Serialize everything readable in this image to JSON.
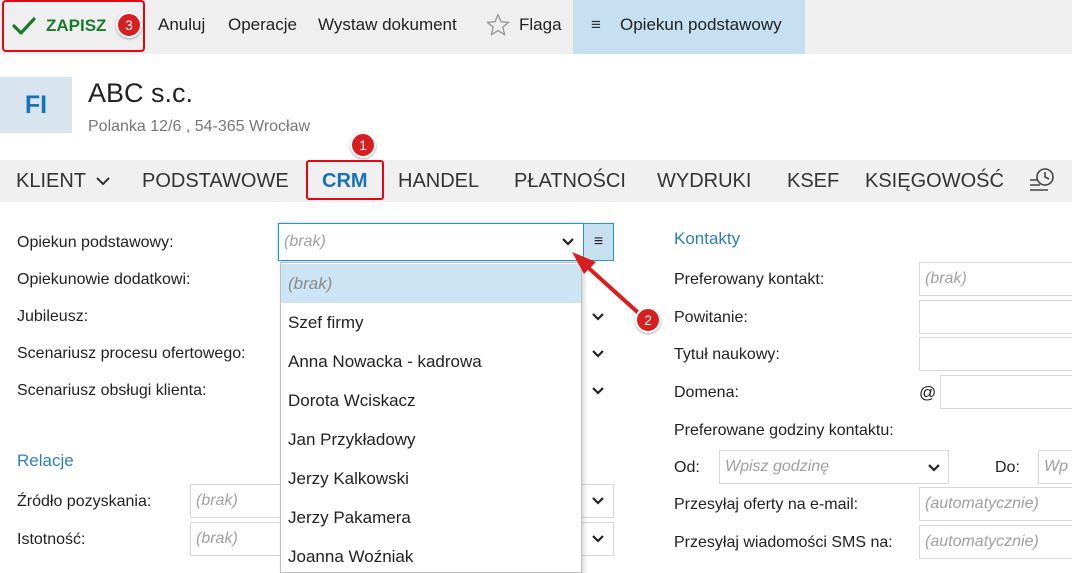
{
  "toolbar": {
    "save_label": "ZAPISZ",
    "cancel_label": "Anuluj",
    "operations_label": "Operacje",
    "issue_document_label": "Wystaw dokument",
    "flag_label": "Flaga",
    "primary_caretaker_label": "Opiekun podstawowy"
  },
  "annotations": {
    "badge_1": "1",
    "badge_2": "2",
    "badge_3": "3"
  },
  "header": {
    "avatar_initials": "FI",
    "company_name": "ABC s.c.",
    "address": "Polanka  12/6 , 54-365 Wrocław"
  },
  "tabs": [
    {
      "label": "KLIENT"
    },
    {
      "label": "PODSTAWOWE"
    },
    {
      "label": "CRM"
    },
    {
      "label": "HANDEL"
    },
    {
      "label": "PŁATNOŚCI"
    },
    {
      "label": "WYDRUKI"
    },
    {
      "label": "KSEF"
    },
    {
      "label": "KSIĘGOWOŚĆ"
    }
  ],
  "crm": {
    "primary_caretaker_label": "Opiekun podstawowy:",
    "primary_caretaker_value": "(brak)",
    "additional_caretakers_label": "Opiekunowie dodatkowi:",
    "anniversary_label": "Jubileusz:",
    "offer_process_label": "Scenariusz procesu ofertowego:",
    "service_scenario_label": "Scenariusz obsługi klienta:",
    "relations_title": "Relacje",
    "source_label": "Źródło pozyskania:",
    "source_value": "(brak)",
    "importance_label": "Istotność:",
    "importance_value": "(brak)"
  },
  "dropdown": {
    "options": [
      "(brak)",
      "Szef firmy",
      "Anna Nowacka - kadrowa",
      "Dorota Wciskacz",
      "Jan Przykładowy",
      "Jerzy Kalkowski",
      "Jerzy Pakamera",
      "Joanna Woźniak"
    ],
    "selected": "(brak)"
  },
  "contacts": {
    "title": "Kontakty",
    "preferred_contact_label": "Preferowany kontakt:",
    "preferred_contact_value": "(brak)",
    "greeting_label": "Powitanie:",
    "title_label": "Tytuł naukowy:",
    "domain_label": "Domena:",
    "domain_prefix": "@",
    "hours_label": "Preferowane godziny kontaktu:",
    "from_label": "Od:",
    "from_placeholder": "Wpisz godzinę",
    "to_label": "Do:",
    "to_placeholder": "Wp",
    "offers_email_label": "Przesyłaj oferty na e-mail:",
    "offers_email_value": "(automatycznie)",
    "sms_label": "Przesyłaj wiadomości SMS na:",
    "sms_value": "(automatycznie)"
  },
  "colors": {
    "accent_blue": "#1673b5",
    "highlight_red": "#e30613",
    "save_green": "#1a7a2c",
    "selected_bg": "#c6e0f2"
  }
}
